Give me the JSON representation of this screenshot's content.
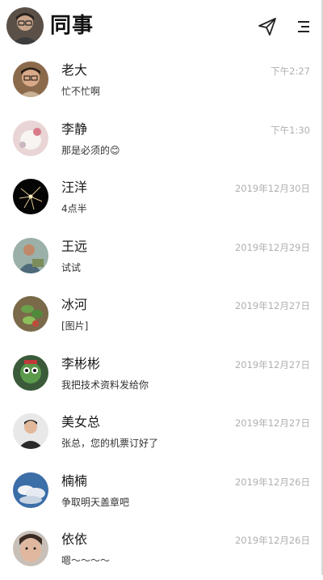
{
  "header": {
    "title": "同事",
    "avatar_icon": "user-avatar",
    "send_icon": "paper-plane-icon",
    "menu_icon": "menu-icon"
  },
  "chats": [
    {
      "name": "老大",
      "time": "下午2:27",
      "message": "忙不忙啊"
    },
    {
      "name": "李静",
      "time": "下午1:30",
      "message": "那是必须的😊"
    },
    {
      "name": "汪洋",
      "time": "2019年12月30日",
      "message": "4点半"
    },
    {
      "name": "王远",
      "time": "2019年12月29日",
      "message": "试试"
    },
    {
      "name": "冰河",
      "time": "2019年12月27日",
      "message": "[图片]"
    },
    {
      "name": "李彬彬",
      "time": "2019年12月27日",
      "message": "我把技术资料发给你"
    },
    {
      "name": "美女总",
      "time": "2019年12月27日",
      "message": "张总，您的机票订好了"
    },
    {
      "name": "楠楠",
      "time": "2019年12月26日",
      "message": "争取明天盖章吧"
    },
    {
      "name": "依依",
      "time": "2019年12月26日",
      "message": "嗯～～～～"
    }
  ],
  "colors": {
    "time": "#b0b0b0",
    "name": "#1a1a1a",
    "message": "#333333"
  }
}
